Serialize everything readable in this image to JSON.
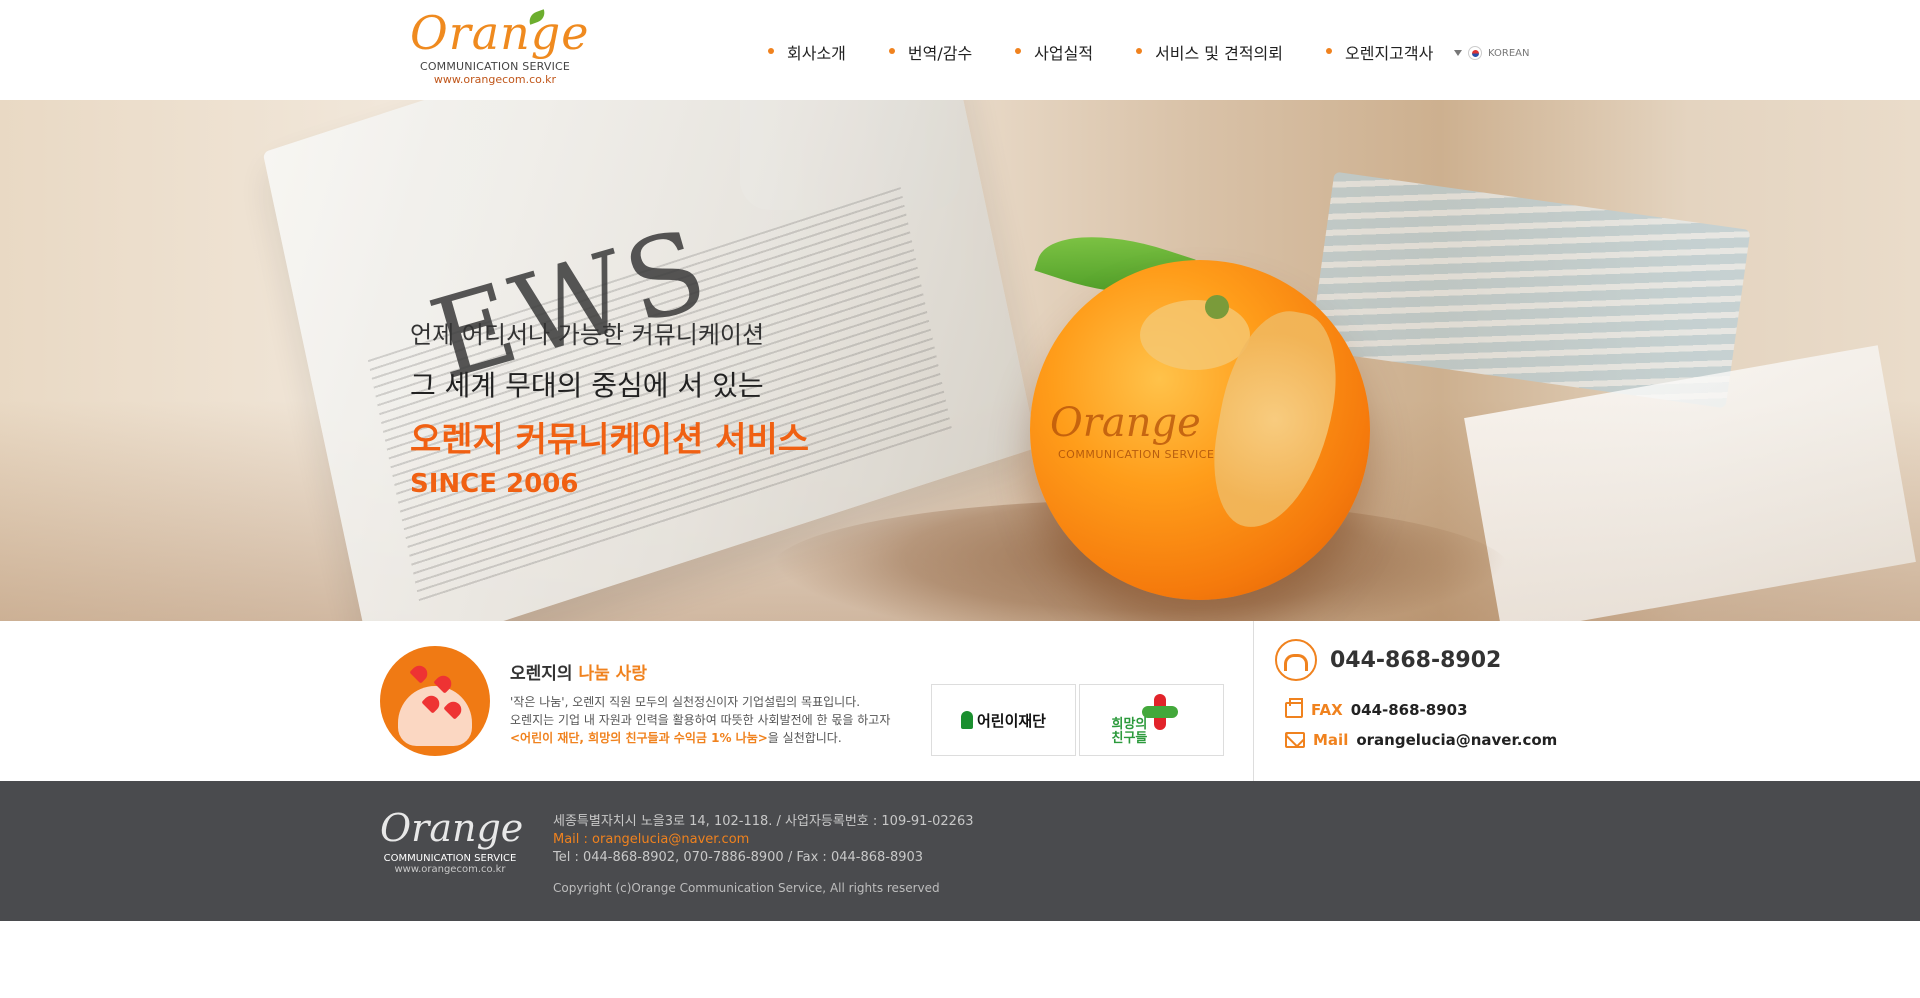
{
  "header": {
    "logo_word": "Orange",
    "logo_sub": "COMMUNICATION SERVICE",
    "logo_url": "www.orangecom.co.kr",
    "nav": [
      "회사소개",
      "번역/감수",
      "사업실적",
      "서비스 및 견적의뢰",
      "오렌지고객사"
    ],
    "language": "KOREAN"
  },
  "hero": {
    "line1": "언제 어디서나 가능한 커뮤니케이션",
    "line2": "그 세계 무대의 중심에 서 있는",
    "line3": "오렌지 커뮤니케이션 서비스",
    "line4": "SINCE 2006",
    "newspaper_text": "EWS",
    "orange_brand": "Orange",
    "orange_brand_sub": "COMMUNICATION SERVICE"
  },
  "sharing": {
    "title_prefix": "오렌지의 ",
    "title_highlight": "나눔 사랑",
    "desc_line1": "'작은 나눔', 오렌지 직원 모두의 실천정신이자 기업설립의 목표입니다.",
    "desc_line2": "오렌지는 기업 내 자원과 인력을 활용하여 따뜻한 사회발전에 한 몫을 하고자",
    "desc_highlight": "<어린이 재단, 희망의 친구들과 수익금 1% 나눔>",
    "desc_suffix": "을 실천합니다."
  },
  "partners": {
    "partner1": "어린이재단",
    "partner2_line1": "희망의",
    "partner2_line2": "친구들"
  },
  "contact": {
    "phone": "044-868-8902",
    "fax_label": "FAX",
    "fax": "044-868-8903",
    "mail_label": "Mail",
    "mail": "orangelucia@naver.com"
  },
  "footer": {
    "logo_word": "Orange",
    "logo_sub": "COMMUNICATION SERVICE",
    "logo_url": "www.orangecom.co.kr",
    "address": "세종특별자치시 노을3로 14, 102-118. / 사업자등록번호 : 109-91-02263",
    "mail": "Mail : orangelucia@naver.com",
    "tel": "Tel : 044-868-8902, 070-7886-8900 / Fax : 044-868-8903",
    "copyright": "Copyright (c)Orange Communication Service, All rights reserved"
  },
  "colors": {
    "accent": "#f0821e",
    "footer_bg": "#4a4b4e"
  }
}
